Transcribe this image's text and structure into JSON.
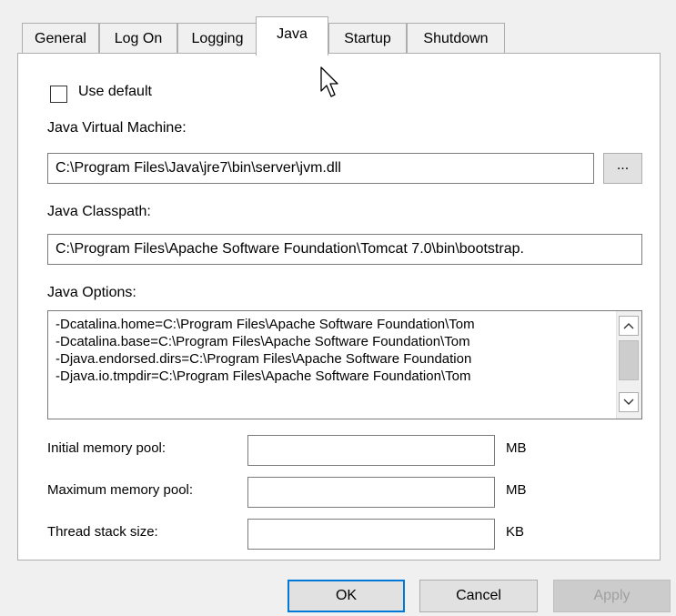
{
  "tabs": [
    {
      "label": "General",
      "active": false
    },
    {
      "label": "Log On",
      "active": false
    },
    {
      "label": "Logging",
      "active": false
    },
    {
      "label": "Java",
      "active": true
    },
    {
      "label": "Startup",
      "active": false
    },
    {
      "label": "Shutdown",
      "active": false
    }
  ],
  "use_default": {
    "label": "Use default",
    "checked": false
  },
  "jvm": {
    "label": "Java Virtual Machine:",
    "value": "C:\\Program Files\\Java\\jre7\\bin\\server\\jvm.dll",
    "browse_label": "..."
  },
  "classpath": {
    "label": "Java Classpath:",
    "value": "C:\\Program Files\\Apache Software Foundation\\Tomcat 7.0\\bin\\bootstrap."
  },
  "options": {
    "label": "Java Options:",
    "lines": [
      "-Dcatalina.home=C:\\Program Files\\Apache Software Foundation\\Tom",
      "-Dcatalina.base=C:\\Program Files\\Apache Software Foundation\\Tom",
      "-Djava.endorsed.dirs=C:\\Program Files\\Apache Software Foundation",
      "-Djava.io.tmpdir=C:\\Program Files\\Apache Software Foundation\\Tom"
    ]
  },
  "memory": {
    "initial": {
      "label": "Initial memory pool:",
      "value": "",
      "unit": "MB"
    },
    "maximum": {
      "label": "Maximum memory pool:",
      "value": "",
      "unit": "MB"
    },
    "thread": {
      "label": "Thread stack size:",
      "value": "",
      "unit": "KB"
    }
  },
  "buttons": {
    "ok": "OK",
    "cancel": "Cancel",
    "apply": "Apply"
  },
  "colors": {
    "focus_border": "#0078d7",
    "panel_bg": "#ffffff",
    "window_bg": "#f0f0f0"
  },
  "icons": {
    "cursor": "mouse-pointer-icon",
    "scroll_up": "chevron-up-icon",
    "scroll_down": "chevron-down-icon"
  }
}
